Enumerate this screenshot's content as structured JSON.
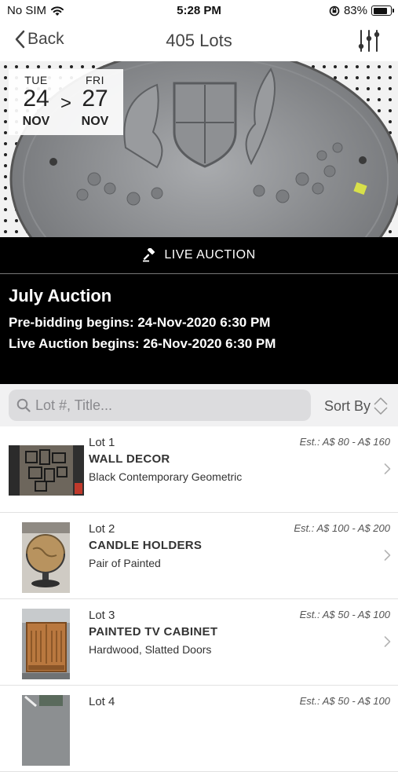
{
  "status_bar": {
    "carrier": "No SIM",
    "time": "5:28 PM",
    "battery_percent": "83%",
    "battery_level": 0.83
  },
  "nav": {
    "back_label": "Back",
    "title": "405 Lots"
  },
  "auction": {
    "start": {
      "dow": "TUE",
      "day": "24",
      "month": "NOV"
    },
    "end": {
      "dow": "FRI",
      "day": "27",
      "month": "NOV"
    },
    "arrow": ">",
    "type_label": "LIVE AUCTION",
    "title": "July Auction",
    "pre_bidding": "Pre-bidding begins: 24-Nov-2020 6:30 PM",
    "live_begins": "Live Auction begins: 26-Nov-2020 6:30 PM"
  },
  "search": {
    "placeholder": "Lot #, Title...",
    "sort_label": "Sort By"
  },
  "lots": [
    {
      "number": "Lot 1",
      "title": "WALL DECOR",
      "description": "Black Contemporary Geometric",
      "estimate": "Est.: A$ 80 - A$ 160"
    },
    {
      "number": "Lot 2",
      "title": "CANDLE HOLDERS",
      "description": "Pair of Painted",
      "estimate": "Est.: A$ 100 - A$ 200"
    },
    {
      "number": "Lot 3",
      "title": "PAINTED TV CABINET",
      "description": "Hardwood, Slatted Doors",
      "estimate": "Est.: A$ 50 - A$ 100"
    },
    {
      "number": "Lot 4",
      "title": "",
      "description": "",
      "estimate": "Est.: A$ 50 - A$ 100"
    }
  ],
  "colors": {
    "panel_bg": "#000000",
    "search_bg": "#f1f1f2",
    "text_gray": "#444444"
  }
}
